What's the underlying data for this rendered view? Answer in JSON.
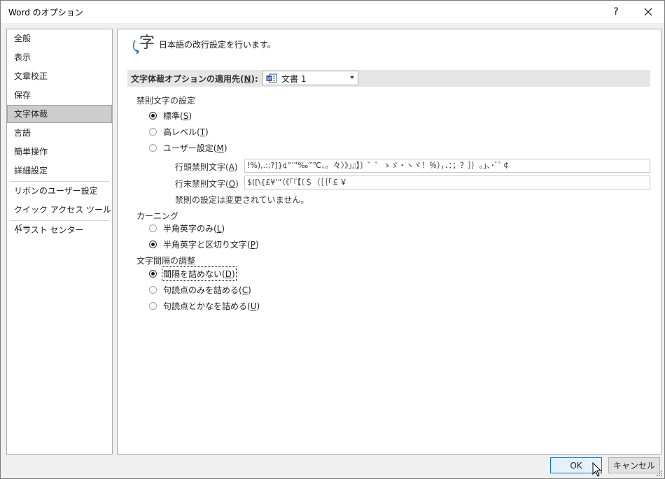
{
  "window": {
    "title": "Word のオプション",
    "help_glyph": "?",
    "close_glyph": "✕"
  },
  "sidebar": {
    "items": [
      {
        "label": "全般"
      },
      {
        "label": "表示"
      },
      {
        "label": "文章校正"
      },
      {
        "label": "保存"
      },
      {
        "label": "文字体裁",
        "selected": true
      },
      {
        "label": "言語"
      },
      {
        "label": "簡単操作"
      },
      {
        "label": "詳細設定"
      },
      {
        "label": "リボンのユーザー設定"
      },
      {
        "label": "クイック アクセス ツール バー"
      },
      {
        "label": "トラスト センター"
      }
    ]
  },
  "header": {
    "icon": "character-layout-icon",
    "text": "日本語の改行設定を行います。"
  },
  "apply_to": {
    "label_prefix": "文字体裁オプションの適用先(",
    "label_key": "N",
    "label_suffix": "):",
    "document": "文書 1"
  },
  "kinsoku": {
    "title": "禁則文字の設定",
    "options": [
      {
        "prefix": "標準(",
        "key": "S",
        "suffix": ")",
        "checked": true
      },
      {
        "prefix": "高レベル(",
        "key": "T",
        "suffix": ")",
        "checked": false
      },
      {
        "prefix": "ユーザー設定(",
        "key": "M",
        "suffix": ")",
        "checked": false
      }
    ],
    "leading_label_prefix": "行頭禁則文字(",
    "leading_label_key": "A",
    "leading_label_suffix": ")",
    "leading_value": "!%),.:;?]}¢°’”‰′″℃、。々〉》」』】〕゛゜ゝゞ・ヽヾ！％），．：；？］｝｡｣､･ﾞﾟ￠",
    "trailing_label_prefix": "行末禁則文字(",
    "trailing_label_key": "O",
    "trailing_label_suffix": ")",
    "trailing_value": "$([\\{£¥‘“〈《「『【〔＄（［｛｢￡￥",
    "note": "禁則の設定は変更されていません。"
  },
  "kerning": {
    "title": "カーニング",
    "options": [
      {
        "prefix": "半角英字のみ(",
        "key": "L",
        "suffix": ")",
        "checked": false
      },
      {
        "prefix": "半角英字と区切り文字(",
        "key": "P",
        "suffix": ")",
        "checked": true
      }
    ]
  },
  "spacing": {
    "title": "文字間隔の調整",
    "options": [
      {
        "prefix": "間隔を詰めない(",
        "key": "D",
        "suffix": ")",
        "checked": true
      },
      {
        "prefix": "句読点のみを詰める(",
        "key": "C",
        "suffix": ")",
        "checked": false
      },
      {
        "prefix": "句読点とかなを詰める(",
        "key": "U",
        "suffix": ")",
        "checked": false
      }
    ]
  },
  "buttons": {
    "ok": "OK",
    "cancel": "キャンセル"
  },
  "colors": {
    "accent": "#0078d7",
    "selected_nav": "#cdcdcd",
    "icon_blue": "#2e75b6"
  }
}
